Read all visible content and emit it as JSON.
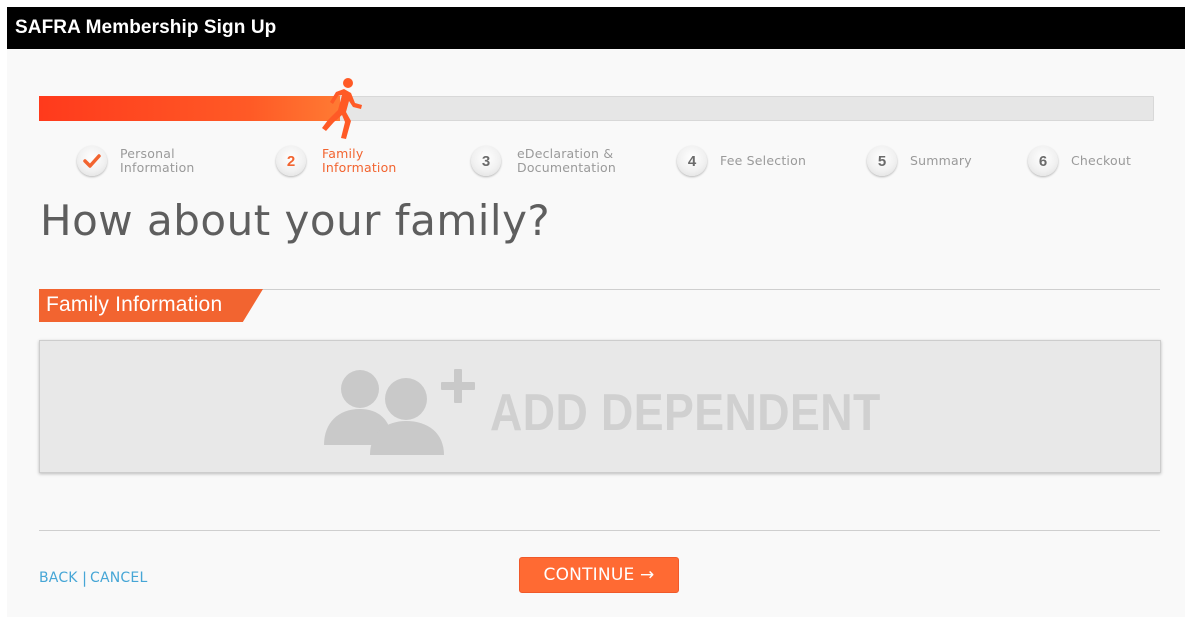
{
  "window": {
    "title": "SAFRA Membership Sign Up"
  },
  "progress": {
    "fraction": 0.27,
    "current_step": 2
  },
  "steps": [
    {
      "number": "",
      "icon": "checkmark-icon",
      "line1": "Personal",
      "line2": "Information",
      "state": "completed"
    },
    {
      "number": "2",
      "line1": "Family",
      "line2": "Information",
      "state": "active"
    },
    {
      "number": "3",
      "line1": "eDeclaration &",
      "line2": "Documentation",
      "state": "pending"
    },
    {
      "number": "4",
      "line1": "Fee Selection",
      "line2": "",
      "state": "pending"
    },
    {
      "number": "5",
      "line1": "Summary",
      "line2": "",
      "state": "pending"
    },
    {
      "number": "6",
      "line1": "Checkout",
      "line2": "",
      "state": "pending"
    }
  ],
  "main": {
    "heading": "How about your family?",
    "section_title": "Family Information",
    "add_dependent_label": "ADD DEPENDENT",
    "add_dependent_icon": "add-users-icon"
  },
  "footer": {
    "back_label": "BACK",
    "separator": "|",
    "cancel_label": "CANCEL",
    "continue_label": "CONTINUE →"
  },
  "colors": {
    "accent": "#f26430",
    "progress": "#ff3a1c",
    "link": "#46a6d6",
    "titlebar": "#000000"
  }
}
